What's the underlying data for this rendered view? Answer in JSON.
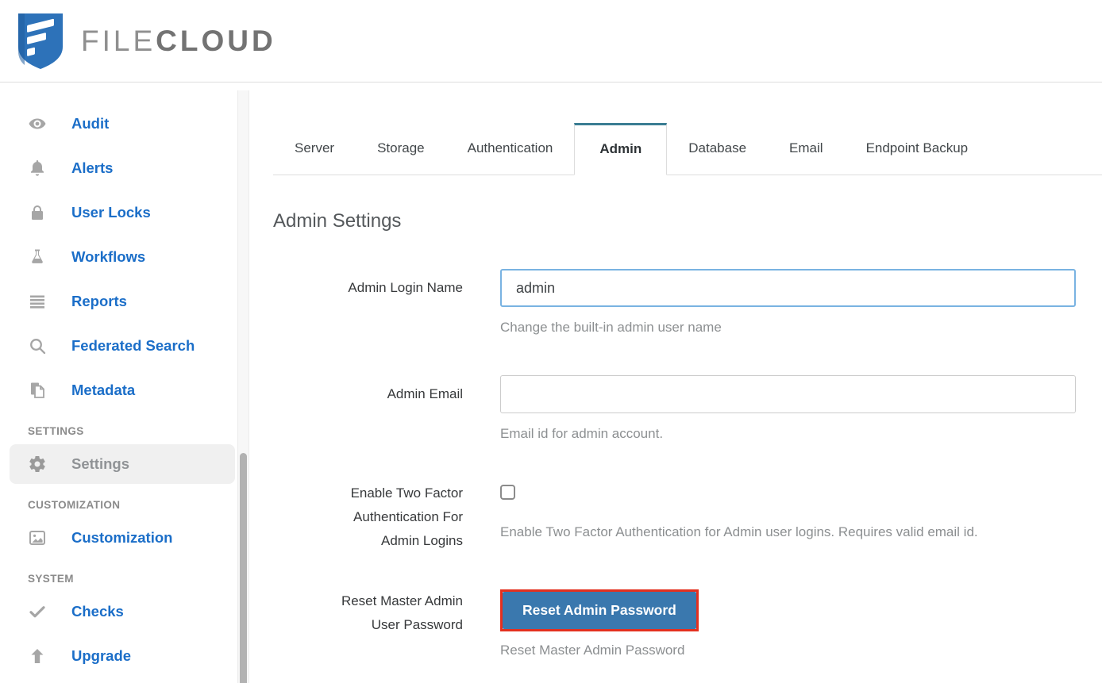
{
  "header": {
    "brand_light": "FILE",
    "brand_bold": "CLOUD"
  },
  "sidebar": {
    "items": [
      {
        "label": "Audit",
        "icon": "eye-icon"
      },
      {
        "label": "Alerts",
        "icon": "bell-icon"
      },
      {
        "label": "User Locks",
        "icon": "lock-icon"
      },
      {
        "label": "Workflows",
        "icon": "flask-icon"
      },
      {
        "label": "Reports",
        "icon": "list-icon"
      },
      {
        "label": "Federated Search",
        "icon": "search-icon"
      },
      {
        "label": "Metadata",
        "icon": "copy-icon"
      },
      {
        "label": "Settings",
        "icon": "gear-icon",
        "active": true
      },
      {
        "label": "Customization",
        "icon": "image-icon"
      },
      {
        "label": "Checks",
        "icon": "check-icon"
      },
      {
        "label": "Upgrade",
        "icon": "arrow-up-icon"
      }
    ],
    "sections": [
      "SETTINGS",
      "CUSTOMIZATION",
      "SYSTEM"
    ]
  },
  "tabs": {
    "labels": [
      "Server",
      "Storage",
      "Authentication",
      "Admin",
      "Database",
      "Email",
      "Endpoint Backup"
    ],
    "active": "Admin"
  },
  "main": {
    "title": "Admin Settings"
  },
  "form": {
    "rows": [
      {
        "label": "Admin Login Name",
        "value": "admin",
        "help": "Change the built-in admin user name"
      },
      {
        "label": "Admin Email",
        "value": "",
        "help": "Email id for admin account."
      },
      {
        "label": "Enable Two Factor Authentication For Admin Logins",
        "checked": false,
        "help": "Enable Two Factor Authentication for Admin user logins. Requires valid email id."
      },
      {
        "label": "Reset Master Admin User Password",
        "button": "Reset Admin Password",
        "help": "Reset Master Admin Password"
      }
    ]
  },
  "colors": {
    "sidebar_link": "#1b6ec8",
    "icon_gray": "#a6a6a6",
    "tab_active_top": "#3a7d93",
    "input_focus_border": "#79b3e2",
    "button_blue": "#3a78ae",
    "highlight_red": "#e4301f",
    "logo_blue": "#2d72b9"
  }
}
